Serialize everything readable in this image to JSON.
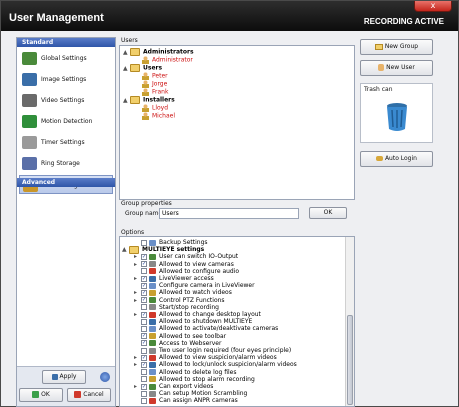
{
  "window": {
    "title": "User Management",
    "status": "RECORDING ACTIVE",
    "close_label": "x"
  },
  "sidebar": {
    "standard_label": "Standard",
    "advanced_label": "Advanced",
    "items": [
      {
        "label": "Global Settings",
        "color": "#4a8a3a"
      },
      {
        "label": "Image Settings",
        "color": "#3a6ea8"
      },
      {
        "label": "Video Settings",
        "color": "#6a6a6a"
      },
      {
        "label": "Motion Detection",
        "color": "#2f8f3a"
      },
      {
        "label": "Timer Settings",
        "color": "#9a9a9a"
      },
      {
        "label": "Ring Storage",
        "color": "#5a6fa8"
      },
      {
        "label": "User Management",
        "color": "#c9962a"
      }
    ],
    "apply_label": "Apply",
    "ok_label": "OK",
    "cancel_label": "Cancel"
  },
  "users": {
    "panel_label": "Users",
    "tree": [
      {
        "label": "Administrators",
        "type": "group"
      },
      {
        "label": "Administrator",
        "type": "user"
      },
      {
        "label": "Users",
        "type": "group"
      },
      {
        "label": "Peter",
        "type": "user"
      },
      {
        "label": "Jorge",
        "type": "user"
      },
      {
        "label": "Frank",
        "type": "user"
      },
      {
        "label": "Installers",
        "type": "group"
      },
      {
        "label": "Lloyd",
        "type": "user"
      },
      {
        "label": "Michael",
        "type": "user"
      }
    ]
  },
  "group_properties": {
    "label": "Group properties",
    "name_label": "Group name",
    "name_value": "Users",
    "ok_label": "OK"
  },
  "options": {
    "label": "Options",
    "rows": [
      {
        "text": "Backup Settings",
        "checked": false,
        "expander": "",
        "indent": 1
      },
      {
        "text": "MULTIEYE settings",
        "checked": false,
        "expander": "▲",
        "indent": 0,
        "bold": true
      },
      {
        "text": "User can switch IO-Output",
        "checked": true,
        "expander": "▸",
        "indent": 1
      },
      {
        "text": "Allowed to view cameras",
        "checked": true,
        "expander": "▸",
        "indent": 1
      },
      {
        "text": "Allowed to configure audio",
        "checked": false,
        "expander": "",
        "indent": 1
      },
      {
        "text": "LiveViewer access",
        "checked": true,
        "expander": "▸",
        "indent": 1
      },
      {
        "text": "Configure camera in LiveViewer",
        "checked": true,
        "expander": "",
        "indent": 1
      },
      {
        "text": "Allowed to watch videos",
        "checked": true,
        "expander": "▸",
        "indent": 1
      },
      {
        "text": "Control PTZ Functions",
        "checked": true,
        "expander": "▸",
        "indent": 1
      },
      {
        "text": "Start/stop recording",
        "checked": false,
        "expander": "",
        "indent": 1
      },
      {
        "text": "Allowed to change desktop layout",
        "checked": true,
        "expander": "▸",
        "indent": 1
      },
      {
        "text": "Allowed to shutdown MULTIEYE",
        "checked": false,
        "expander": "",
        "indent": 1
      },
      {
        "text": "Allowed to activate/deaktivate cameras",
        "checked": false,
        "expander": "",
        "indent": 1
      },
      {
        "text": "Allowed to see toolbar",
        "checked": true,
        "expander": "",
        "indent": 1
      },
      {
        "text": "Access to Webserver",
        "checked": true,
        "expander": "",
        "indent": 1
      },
      {
        "text": "Two user login required (four eyes principle)",
        "checked": false,
        "expander": "",
        "indent": 1
      },
      {
        "text": "Allowed to view suspicion/alarm videos",
        "checked": true,
        "expander": "▸",
        "indent": 1
      },
      {
        "text": "Allowed to lock/unlock suspicion/alarm videos",
        "checked": true,
        "expander": "▸",
        "indent": 1
      },
      {
        "text": "Allowed to delete log files",
        "checked": false,
        "expander": "",
        "indent": 1
      },
      {
        "text": "Allowed to stop alarm recording",
        "checked": false,
        "expander": "",
        "indent": 1
      },
      {
        "text": "Can export videos",
        "checked": true,
        "expander": "▸",
        "indent": 1
      },
      {
        "text": "Can setup Motion Scrambling",
        "checked": false,
        "expander": "",
        "indent": 1
      },
      {
        "text": "Can assign ANPR cameras",
        "checked": false,
        "expander": "",
        "indent": 1
      }
    ]
  },
  "actions": {
    "new_group": "New Group",
    "new_user": "New User",
    "trash_label": "Trash can",
    "auto_login": "Auto Login"
  }
}
